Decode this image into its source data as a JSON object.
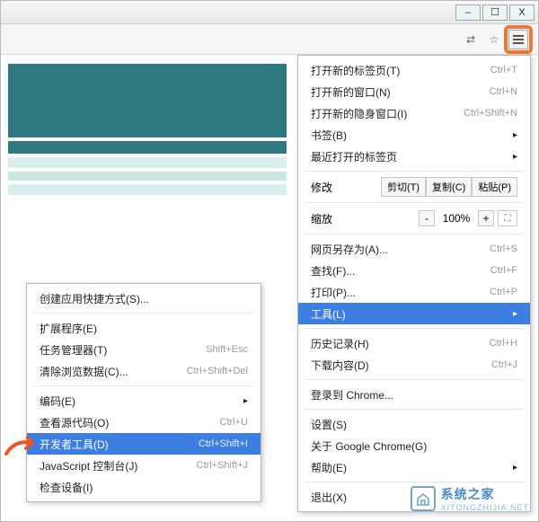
{
  "window": {
    "min": "–",
    "max": "☐",
    "close": "X"
  },
  "main_menu": {
    "new_tab": {
      "label": "打开新的标签页(T)",
      "shortcut": "Ctrl+T"
    },
    "new_window": {
      "label": "打开新的窗口(N)",
      "shortcut": "Ctrl+N"
    },
    "incognito": {
      "label": "打开新的隐身窗口(I)",
      "shortcut": "Ctrl+Shift+N"
    },
    "bookmarks": {
      "label": "书签(B)"
    },
    "recent_tabs": {
      "label": "最近打开的标签页"
    },
    "edit_label": "修改",
    "cut": "剪切(T)",
    "copy": "复制(C)",
    "paste": "粘贴(P)",
    "zoom_label": "缩放",
    "zoom_value": "100%",
    "save_as": {
      "label": "网页另存为(A)...",
      "shortcut": "Ctrl+S"
    },
    "find": {
      "label": "查找(F)...",
      "shortcut": "Ctrl+F"
    },
    "print": {
      "label": "打印(P)...",
      "shortcut": "Ctrl+P"
    },
    "tools": {
      "label": "工具(L)"
    },
    "history": {
      "label": "历史记录(H)",
      "shortcut": "Ctrl+H"
    },
    "downloads": {
      "label": "下载内容(D)",
      "shortcut": "Ctrl+J"
    },
    "signin": {
      "label": "登录到 Chrome..."
    },
    "settings": {
      "label": "设置(S)"
    },
    "about": {
      "label": "关于 Google Chrome(G)"
    },
    "help": {
      "label": "帮助(E)"
    },
    "exit": {
      "label": "退出(X)"
    }
  },
  "submenu": {
    "create_shortcut": {
      "label": "创建应用快捷方式(S)..."
    },
    "extensions": {
      "label": "扩展程序(E)"
    },
    "task_manager": {
      "label": "任务管理器(T)",
      "shortcut": "Shift+Esc"
    },
    "clear_data": {
      "label": "清除浏览数据(C)...",
      "shortcut": "Ctrl+Shift+Del"
    },
    "encoding": {
      "label": "编码(E)"
    },
    "view_source": {
      "label": "查看源代码(O)",
      "shortcut": "Ctrl+U"
    },
    "dev_tools": {
      "label": "开发者工具(D)",
      "shortcut": "Ctrl+Shift+I"
    },
    "js_console": {
      "label": "JavaScript 控制台(J)",
      "shortcut": "Ctrl+Shift+J"
    },
    "inspect": {
      "label": "检查设备(I)"
    }
  },
  "watermark": {
    "title": "系统之家",
    "url": "XITONGZHIJIA.NET"
  }
}
